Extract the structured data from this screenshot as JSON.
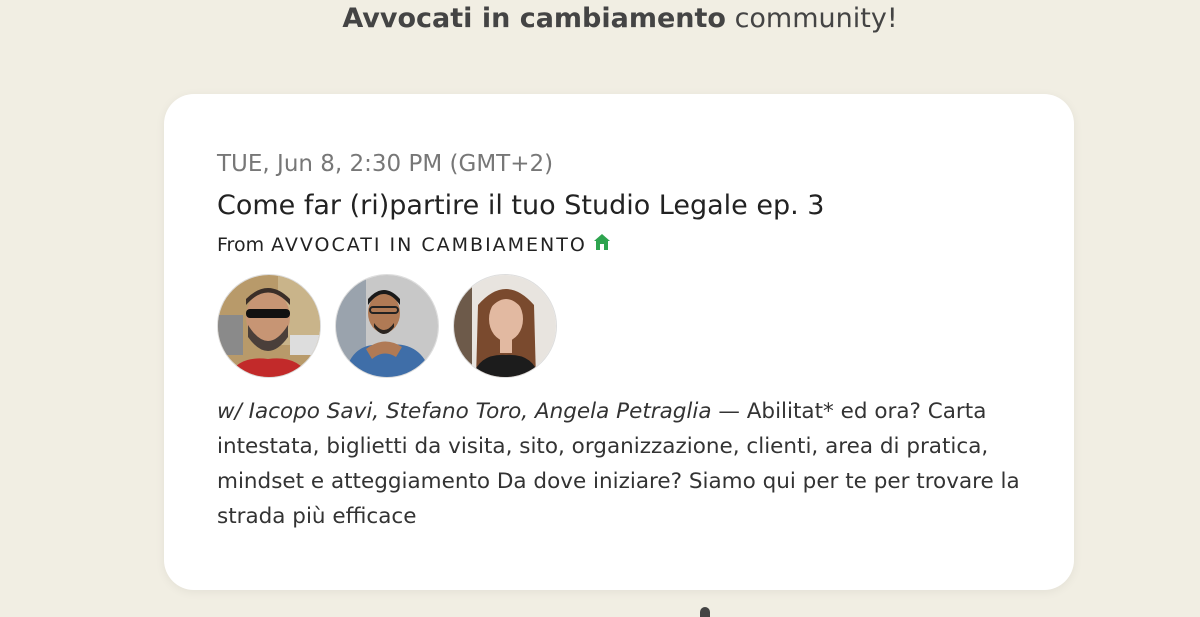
{
  "headline": {
    "strong": "Avvocati in cambiamento",
    "rest": " community!"
  },
  "event": {
    "date": "TUE, Jun 8, 2:30 PM (GMT+2)",
    "title": "Come far (ri)partire il tuo Studio Legale ep. 3",
    "from_label": "From",
    "organizer": "AVVOCATI IN CAMBIAMENTO",
    "organizer_icon": "house-icon",
    "accent_color": "#2ea44f",
    "hosts": "w/ Iacopo Savi, Stefano Toro, Angela Petraglia",
    "description": " — Abilitat* ed ora? Carta intestata, biglietti da visita, sito, organizzazione, clienti, area di pratica, mindset e atteggiamento Da dove iniziare? Siamo qui per te per trovare la strada più efficace"
  }
}
